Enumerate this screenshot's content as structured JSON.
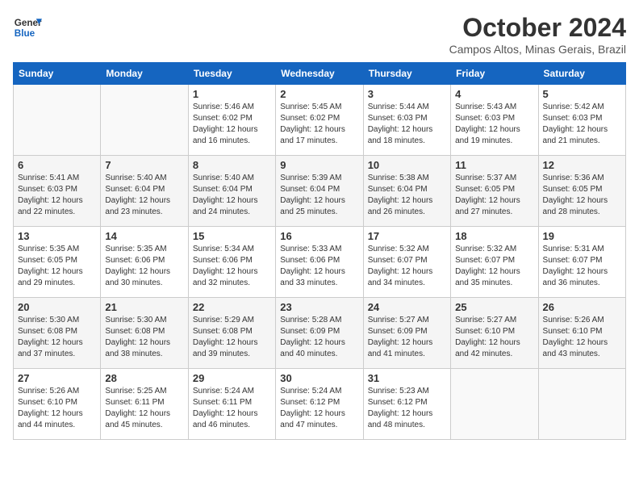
{
  "header": {
    "logo_general": "General",
    "logo_blue": "Blue",
    "month": "October 2024",
    "location": "Campos Altos, Minas Gerais, Brazil"
  },
  "columns": [
    "Sunday",
    "Monday",
    "Tuesday",
    "Wednesday",
    "Thursday",
    "Friday",
    "Saturday"
  ],
  "weeks": [
    [
      {
        "day": "",
        "info": ""
      },
      {
        "day": "",
        "info": ""
      },
      {
        "day": "1",
        "info": "Sunrise: 5:46 AM\nSunset: 6:02 PM\nDaylight: 12 hours\nand 16 minutes."
      },
      {
        "day": "2",
        "info": "Sunrise: 5:45 AM\nSunset: 6:02 PM\nDaylight: 12 hours\nand 17 minutes."
      },
      {
        "day": "3",
        "info": "Sunrise: 5:44 AM\nSunset: 6:03 PM\nDaylight: 12 hours\nand 18 minutes."
      },
      {
        "day": "4",
        "info": "Sunrise: 5:43 AM\nSunset: 6:03 PM\nDaylight: 12 hours\nand 19 minutes."
      },
      {
        "day": "5",
        "info": "Sunrise: 5:42 AM\nSunset: 6:03 PM\nDaylight: 12 hours\nand 21 minutes."
      }
    ],
    [
      {
        "day": "6",
        "info": "Sunrise: 5:41 AM\nSunset: 6:03 PM\nDaylight: 12 hours\nand 22 minutes."
      },
      {
        "day": "7",
        "info": "Sunrise: 5:40 AM\nSunset: 6:04 PM\nDaylight: 12 hours\nand 23 minutes."
      },
      {
        "day": "8",
        "info": "Sunrise: 5:40 AM\nSunset: 6:04 PM\nDaylight: 12 hours\nand 24 minutes."
      },
      {
        "day": "9",
        "info": "Sunrise: 5:39 AM\nSunset: 6:04 PM\nDaylight: 12 hours\nand 25 minutes."
      },
      {
        "day": "10",
        "info": "Sunrise: 5:38 AM\nSunset: 6:04 PM\nDaylight: 12 hours\nand 26 minutes."
      },
      {
        "day": "11",
        "info": "Sunrise: 5:37 AM\nSunset: 6:05 PM\nDaylight: 12 hours\nand 27 minutes."
      },
      {
        "day": "12",
        "info": "Sunrise: 5:36 AM\nSunset: 6:05 PM\nDaylight: 12 hours\nand 28 minutes."
      }
    ],
    [
      {
        "day": "13",
        "info": "Sunrise: 5:35 AM\nSunset: 6:05 PM\nDaylight: 12 hours\nand 29 minutes."
      },
      {
        "day": "14",
        "info": "Sunrise: 5:35 AM\nSunset: 6:06 PM\nDaylight: 12 hours\nand 30 minutes."
      },
      {
        "day": "15",
        "info": "Sunrise: 5:34 AM\nSunset: 6:06 PM\nDaylight: 12 hours\nand 32 minutes."
      },
      {
        "day": "16",
        "info": "Sunrise: 5:33 AM\nSunset: 6:06 PM\nDaylight: 12 hours\nand 33 minutes."
      },
      {
        "day": "17",
        "info": "Sunrise: 5:32 AM\nSunset: 6:07 PM\nDaylight: 12 hours\nand 34 minutes."
      },
      {
        "day": "18",
        "info": "Sunrise: 5:32 AM\nSunset: 6:07 PM\nDaylight: 12 hours\nand 35 minutes."
      },
      {
        "day": "19",
        "info": "Sunrise: 5:31 AM\nSunset: 6:07 PM\nDaylight: 12 hours\nand 36 minutes."
      }
    ],
    [
      {
        "day": "20",
        "info": "Sunrise: 5:30 AM\nSunset: 6:08 PM\nDaylight: 12 hours\nand 37 minutes."
      },
      {
        "day": "21",
        "info": "Sunrise: 5:30 AM\nSunset: 6:08 PM\nDaylight: 12 hours\nand 38 minutes."
      },
      {
        "day": "22",
        "info": "Sunrise: 5:29 AM\nSunset: 6:08 PM\nDaylight: 12 hours\nand 39 minutes."
      },
      {
        "day": "23",
        "info": "Sunrise: 5:28 AM\nSunset: 6:09 PM\nDaylight: 12 hours\nand 40 minutes."
      },
      {
        "day": "24",
        "info": "Sunrise: 5:27 AM\nSunset: 6:09 PM\nDaylight: 12 hours\nand 41 minutes."
      },
      {
        "day": "25",
        "info": "Sunrise: 5:27 AM\nSunset: 6:10 PM\nDaylight: 12 hours\nand 42 minutes."
      },
      {
        "day": "26",
        "info": "Sunrise: 5:26 AM\nSunset: 6:10 PM\nDaylight: 12 hours\nand 43 minutes."
      }
    ],
    [
      {
        "day": "27",
        "info": "Sunrise: 5:26 AM\nSunset: 6:10 PM\nDaylight: 12 hours\nand 44 minutes."
      },
      {
        "day": "28",
        "info": "Sunrise: 5:25 AM\nSunset: 6:11 PM\nDaylight: 12 hours\nand 45 minutes."
      },
      {
        "day": "29",
        "info": "Sunrise: 5:24 AM\nSunset: 6:11 PM\nDaylight: 12 hours\nand 46 minutes."
      },
      {
        "day": "30",
        "info": "Sunrise: 5:24 AM\nSunset: 6:12 PM\nDaylight: 12 hours\nand 47 minutes."
      },
      {
        "day": "31",
        "info": "Sunrise: 5:23 AM\nSunset: 6:12 PM\nDaylight: 12 hours\nand 48 minutes."
      },
      {
        "day": "",
        "info": ""
      },
      {
        "day": "",
        "info": ""
      }
    ]
  ]
}
